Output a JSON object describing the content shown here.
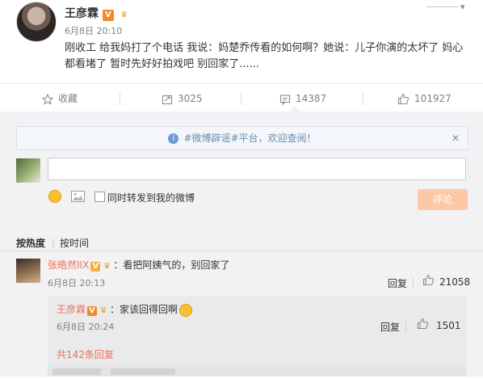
{
  "post": {
    "author": "王彦霖",
    "time": "6月8日 20:10",
    "text": "刚收工 给我妈打了个电话 我说：妈楚乔传看的如何啊？她说：儿子你演的太坏了 妈心都看堵了 暂时先好好拍戏吧 别回家了......"
  },
  "actions": {
    "favorite": "收藏",
    "forward_count": "3025",
    "comment_count": "14387",
    "like_count": "101927"
  },
  "notice": {
    "text": "#微博辟谣#平台，欢迎查阅！",
    "close": "✕"
  },
  "composer": {
    "input_value": "",
    "forward_label": "同时转发到我的微博",
    "submit_label": "评论"
  },
  "sort": {
    "hot": "按热度",
    "time": "按时间"
  },
  "comments": [
    {
      "user": "张皓然IIX",
      "text": "：看把阿姨气的，别回家了",
      "time": "6月8日 20:13",
      "reply_label": "回复",
      "likes": "21058",
      "replies": [
        {
          "user": "王彦霖",
          "text": "：家该回得回啊",
          "time": "6月8日 20:24",
          "reply_label": "回复",
          "likes": "1501"
        }
      ],
      "more_replies": "共142条回复"
    }
  ],
  "colors": {
    "accent": "#eb7350",
    "muted": "#808080",
    "panel": "#f2f2f5",
    "notice_text": "#6a8aa8",
    "submit_disabled": "#fcc8a5"
  },
  "icons": [
    "verified-v-icon",
    "vip-icon",
    "star-icon",
    "forward-icon",
    "comment-icon",
    "like-icon",
    "info-icon",
    "emoji-icon",
    "image-icon",
    "chevron-down-icon"
  ]
}
